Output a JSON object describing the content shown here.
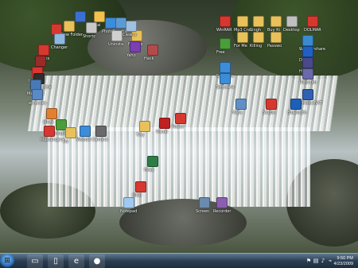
{
  "desktop": {
    "wallpaper": "waterfall",
    "icons": [
      {
        "label": "",
        "color": "#d6382f"
      },
      {
        "label": "",
        "color": "#3b6fd4"
      },
      {
        "label": "Arcai",
        "color": "#f2c14e"
      },
      {
        "label": "Photo",
        "color": "#3c8dd9"
      },
      {
        "label": "New Folder",
        "color": "#e8c15a"
      },
      {
        "label": "Shortc",
        "color": "#c9c9c9"
      },
      {
        "label": "Graphic",
        "color": "#5b9bd5"
      },
      {
        "label": "Changer",
        "color": "#8fb8e0"
      },
      {
        "label": "Uninsta",
        "color": "#cfcfcf"
      },
      {
        "label": "Final Yo",
        "color": "#e8c15a"
      },
      {
        "label": "Cleanu",
        "color": "#a0c0e0"
      },
      {
        "label": "dHacks",
        "color": "#d6382f"
      },
      {
        "label": "HACK",
        "color": "#9a2b2b"
      },
      {
        "label": "Yaho",
        "color": "#7a3fb0"
      },
      {
        "label": "Hack",
        "color": "#b34b4b"
      },
      {
        "label": "Ixplorer",
        "color": "#d6382f"
      },
      {
        "label": "matrix_the",
        "color": "#2f2f2f"
      },
      {
        "label": "Machine",
        "color": "#4a7ab5"
      },
      {
        "label": "ed Acces",
        "color": "#5a8ac5"
      },
      {
        "label": "blaze",
        "color": "#e08030"
      },
      {
        "label": "Google",
        "color": "#4a9d3a"
      },
      {
        "label": "Messenger",
        "color": "#d6382f"
      },
      {
        "label": "Toy",
        "color": "#e8c15a"
      },
      {
        "label": "Wonder",
        "color": "#3c8dd9"
      },
      {
        "label": "Camera",
        "color": "#6a6a6a"
      },
      {
        "label": "Tiny",
        "color": "#e8c15a"
      },
      {
        "label": "Visual",
        "color": "#c02020"
      },
      {
        "label": "Hasp",
        "color": "#2d7d46"
      },
      {
        "label": "Killer",
        "color": "#d6382f"
      },
      {
        "label": "Notepad",
        "color": "#a0c8f0"
      },
      {
        "label": "Screen",
        "color": "#6a8ab0"
      },
      {
        "label": "Recorder",
        "color": "#8a5fb0"
      },
      {
        "label": "WinRAR",
        "color": "#d6382f"
      },
      {
        "label": "Mp3 Cra",
        "color": "#e8c15a"
      },
      {
        "label": "Singh",
        "color": "#e8c15a"
      },
      {
        "label": "Buy Ri",
        "color": "#e8c15a"
      },
      {
        "label": "Desktop",
        "color": "#c0c0c0"
      },
      {
        "label": "DOLMAR",
        "color": "#d6382f"
      },
      {
        "label": "For Me",
        "color": "#e8c15a"
      },
      {
        "label": "Killing",
        "color": "#e8c15a"
      },
      {
        "label": "Passwo",
        "color": "#e8c15a"
      },
      {
        "label": "Free",
        "color": "#4a9d3a"
      },
      {
        "label": "Software",
        "color": "#3c8dd9"
      },
      {
        "label": "Wondershare",
        "color": "#3a8ad0"
      },
      {
        "label": "DVD",
        "color": "#2060c0"
      },
      {
        "label": "Hide IP",
        "color": "#4a4a8a"
      },
      {
        "label": "Platinum",
        "color": "#6a6aaa"
      },
      {
        "label": "UniblueNXT",
        "color": "#3060b0"
      },
      {
        "label": "Bluetooth",
        "color": "#1e5fb8"
      },
      {
        "label": "Vista",
        "color": "#5f8fc5"
      },
      {
        "label": "Studio",
        "color": "#d6382f"
      },
      {
        "label": "Software",
        "color": "#3c8dd9"
      },
      {
        "label": "Power",
        "color": "#d6382f"
      }
    ],
    "selected_icon": "",
    "taskbar": {
      "start_icon": "windows-orb",
      "pinned": [
        {
          "name": "windows-explorer",
          "glyph": "▭"
        },
        {
          "name": "folder",
          "glyph": "▯"
        },
        {
          "name": "internet-explorer",
          "glyph": "e"
        },
        {
          "name": "firefox",
          "glyph": "●"
        }
      ],
      "tray": [
        "flag-icon",
        "network-icon",
        "volume-icon",
        "usb-icon"
      ],
      "time": "9:50 PM",
      "date": "4/23/2009"
    }
  }
}
